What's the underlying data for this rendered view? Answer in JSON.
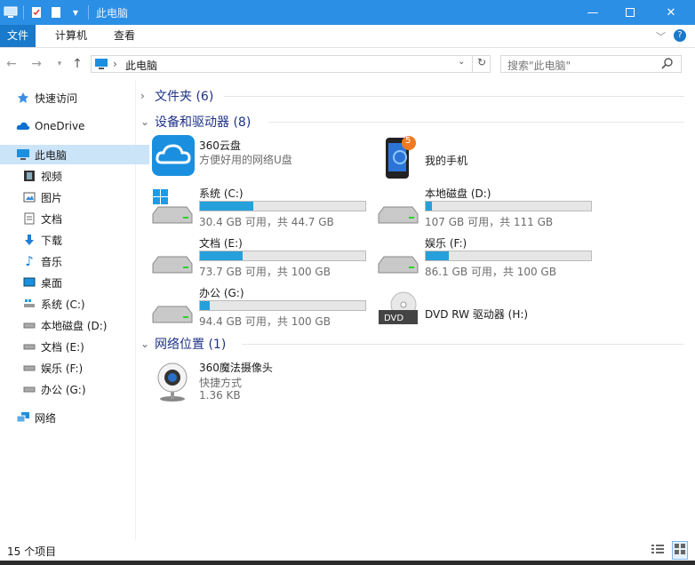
{
  "window": {
    "title": "此电脑",
    "accent": "#2b8fe6"
  },
  "ribbon": {
    "tabs": [
      "文件",
      "计算机",
      "查看"
    ]
  },
  "address": {
    "path": "此电脑",
    "search_placeholder": "搜索\"此电脑\""
  },
  "sidebar": {
    "items": [
      {
        "label": "快速访问",
        "icon": "star-icon"
      },
      {
        "label": "OneDrive",
        "icon": "cloud-icon"
      },
      {
        "label": "此电脑",
        "icon": "computer-icon",
        "selected": true
      },
      {
        "label": "视频",
        "icon": "video-icon"
      },
      {
        "label": "图片",
        "icon": "picture-icon"
      },
      {
        "label": "文档",
        "icon": "document-icon"
      },
      {
        "label": "下载",
        "icon": "download-icon"
      },
      {
        "label": "音乐",
        "icon": "music-icon"
      },
      {
        "label": "桌面",
        "icon": "desktop-icon"
      },
      {
        "label": "系统 (C:)",
        "icon": "drive-icon"
      },
      {
        "label": "本地磁盘 (D:)",
        "icon": "drive-icon"
      },
      {
        "label": "文档 (E:)",
        "icon": "drive-icon"
      },
      {
        "label": "娱乐 (F:)",
        "icon": "drive-icon"
      },
      {
        "label": "办公 (G:)",
        "icon": "drive-icon"
      },
      {
        "label": "网络",
        "icon": "network-icon"
      }
    ]
  },
  "groups": {
    "folders": "文件夹 (6)",
    "devices": "设备和驱动器 (8)",
    "network": "网络位置 (1)"
  },
  "apps": {
    "cloud": {
      "name": "360云盘",
      "desc": "方便好用的网络U盘"
    },
    "phone": {
      "name": "我的手机",
      "badge": "5"
    }
  },
  "drives": [
    {
      "name": "系统 (C:)",
      "sub": "30.4 GB 可用，共 44.7 GB",
      "used": 0.32,
      "windows": true
    },
    {
      "name": "本地磁盘 (D:)",
      "sub": "107 GB 可用，共 111 GB",
      "used": 0.04
    },
    {
      "name": "文档 (E:)",
      "sub": "73.7 GB 可用，共 100 GB",
      "used": 0.26
    },
    {
      "name": "娱乐 (F:)",
      "sub": "86.1 GB 可用，共 100 GB",
      "used": 0.14
    },
    {
      "name": "办公 (G:)",
      "sub": "94.4 GB 可用，共 100 GB",
      "used": 0.06
    }
  ],
  "dvd": {
    "name": "DVD RW 驱动器 (H:)",
    "label": "DVD"
  },
  "camera": {
    "name": "360魔法摄像头",
    "type": "快捷方式",
    "size": "1.36 KB"
  },
  "status": {
    "count": "15 个项目"
  }
}
